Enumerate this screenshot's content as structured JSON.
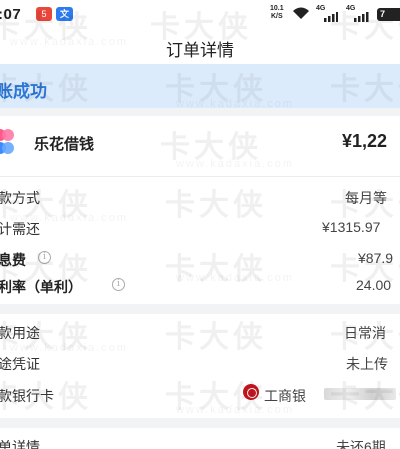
{
  "status_bar": {
    "time": ":07",
    "badge_red": "5",
    "badge_blue": "文",
    "net_speed_top": "10.1",
    "net_speed_bottom": "K/S",
    "net1": "4G",
    "net2": "4G",
    "battery": "7"
  },
  "header": {
    "title": "订单详情"
  },
  "banner": {
    "text": "账成功"
  },
  "product": {
    "name": "乐花借钱",
    "amount": "¥1,22"
  },
  "summary": {
    "repay_method_label": "款方式",
    "repay_method_value": "每月等",
    "total_due_label": "计需还",
    "total_due_value": "¥1315.97",
    "interest_label": "息费",
    "interest_value": "¥87.9",
    "rate_label": "利率（单利）",
    "rate_value": "24.00"
  },
  "details": {
    "purpose_label": "款用途",
    "purpose_value": "日常消",
    "voucher_label": "途凭证",
    "voucher_value": "未上传",
    "bank_label": "款银行卡",
    "bank_value": "工商银"
  },
  "bottom": {
    "label": "单详情",
    "value": "未还6期"
  },
  "watermark": {
    "text": "卡大侠",
    "url": "www.kadaxia.com"
  },
  "colors": {
    "banner_bg": "#dcebfb",
    "banner_text": "#2d78d8",
    "bank_red": "#c7161e"
  }
}
